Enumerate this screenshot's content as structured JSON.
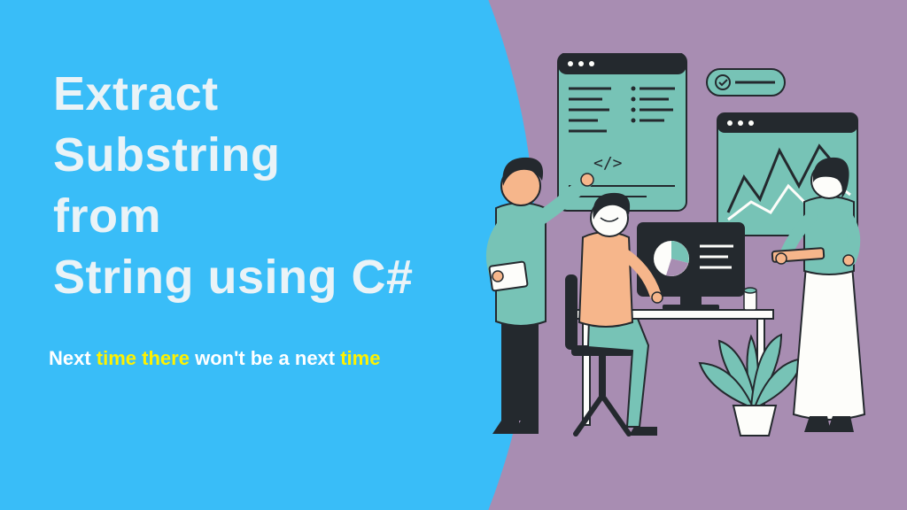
{
  "title": {
    "line1": "Extract",
    "line2": "Substring",
    "line3": "from",
    "line4": "String using C#"
  },
  "subtitle": {
    "parts": [
      {
        "text": "Next ",
        "highlight": false
      },
      {
        "text": "time",
        "highlight": true
      },
      {
        "text": " ",
        "highlight": false
      },
      {
        "text": "there",
        "highlight": true
      },
      {
        "text": " won't be a next ",
        "highlight": false
      },
      {
        "text": "time",
        "highlight": true
      }
    ]
  },
  "colors": {
    "blue": "#39bdf8",
    "purple": "#a88db2",
    "titleText": "#eaf3f7",
    "highlight": "#fff200",
    "teal": "#77c3b6",
    "dark": "#24292e",
    "skin": "#f6b68b",
    "white": "#fdfdfa"
  },
  "illustration": {
    "description": "office-team-analytics",
    "items": [
      "code-panel",
      "status-badge",
      "line-chart-panel",
      "monitor-pie-chart",
      "desk",
      "person-standing-pointing",
      "person-sitting-chair",
      "person-standing-clipboard",
      "potted-plant",
      "cup"
    ]
  }
}
